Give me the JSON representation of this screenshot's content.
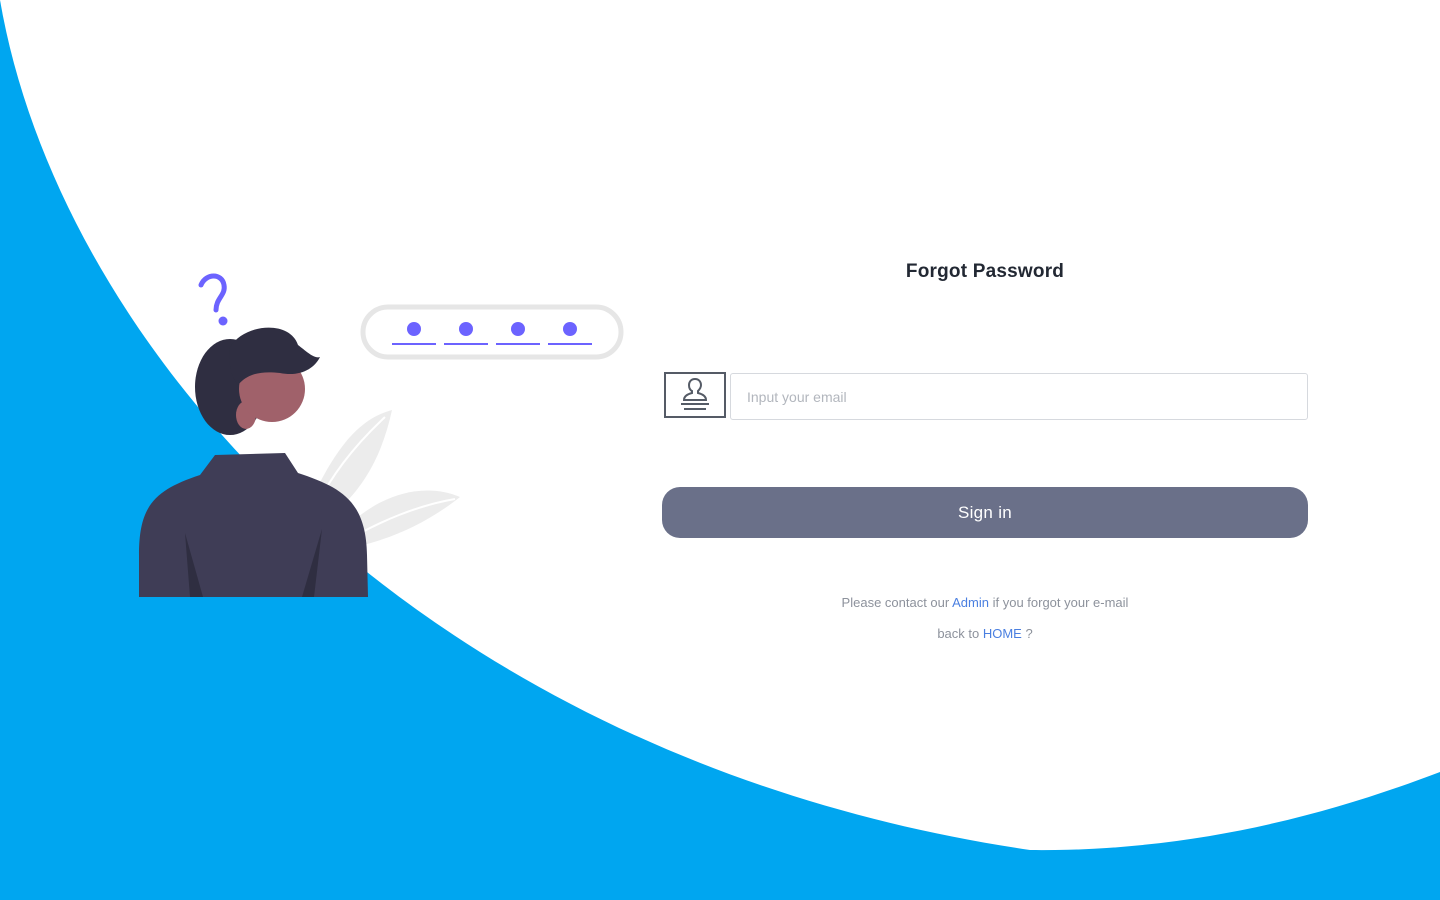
{
  "theme": {
    "background_blue": "#00a6f0",
    "button_color": "#6a7089",
    "link_color": "#4a7fe0",
    "accent_purple": "#6c63ff"
  },
  "illustration": {
    "icons": [
      "person-icon",
      "question-mark-icon",
      "password-dots-icon",
      "plant-icon"
    ]
  },
  "form": {
    "title": "Forgot Password",
    "email": {
      "icon": "user-card-icon",
      "placeholder": "Input your email",
      "value": ""
    },
    "signin_label": "Sign in"
  },
  "help": {
    "line1_prefix": "Please contact our ",
    "line1_link": "Admin",
    "line1_suffix": " if you forgot your e-mail",
    "line2_prefix": "back to ",
    "line2_link": "HOME",
    "line2_suffix": " ?"
  }
}
